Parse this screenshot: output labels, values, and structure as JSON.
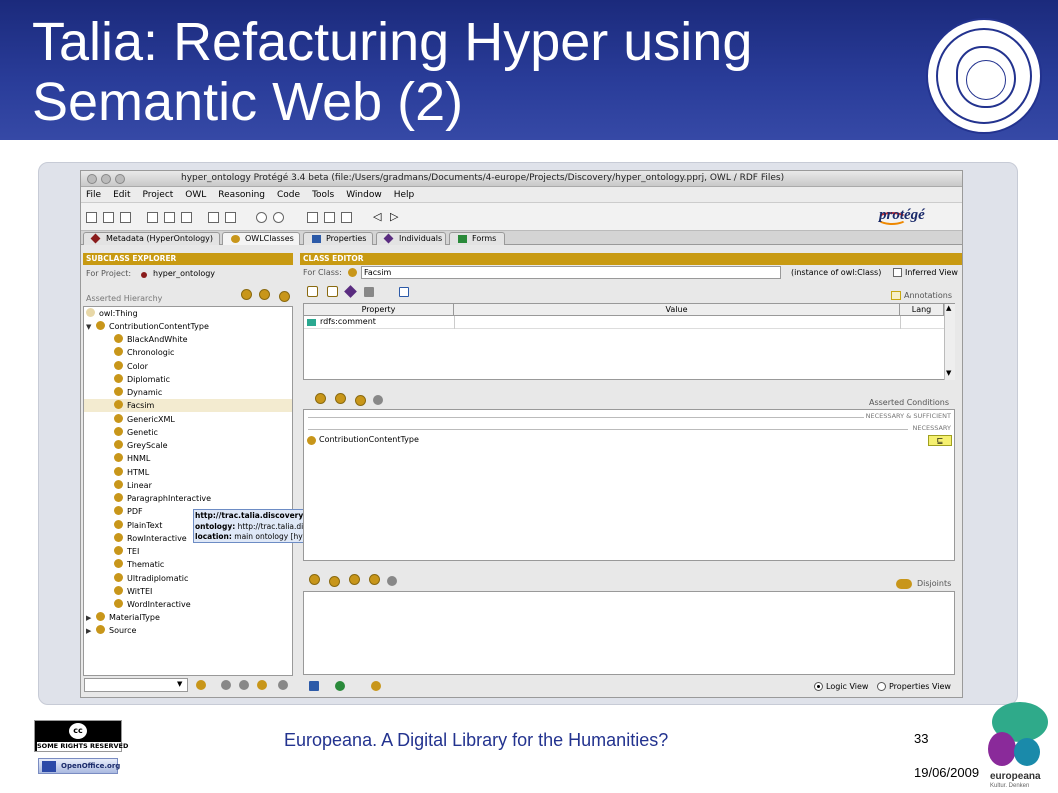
{
  "slide": {
    "title": "Talia: Refacturing Hyper using Semantic Web (2)",
    "footer": "Europeana. A Digital Library for the Humanities?",
    "page_number": "33",
    "date": "19/06/2009",
    "cc_badge": "SOME RIGHTS RESERVED",
    "cc_symbol": "cc",
    "openoffice_badge": "OpenOffice.org",
    "europeana_logo": "europeana",
    "europeana_sub": "Kultur. Denken"
  },
  "window": {
    "title": "hyper_ontology  Protégé 3.4 beta   (file:/Users/gradmans/Documents/4-europe/Projects/Discovery/hyper_ontology.pprj, OWL / RDF Files)",
    "menu": [
      "File",
      "Edit",
      "Project",
      "OWL",
      "Reasoning",
      "Code",
      "Tools",
      "Window",
      "Help"
    ],
    "logo": "protégé"
  },
  "tabs": [
    "Metadata (HyperOntology)",
    "OWLClasses",
    "Properties",
    "Individuals",
    "Forms"
  ],
  "subclass_explorer": {
    "header": "SUBCLASS EXPLORER",
    "for_project_label": "For Project:",
    "project": "hyper_ontology",
    "asserted_hierarchy": "Asserted Hierarchy",
    "root": "owl:Thing",
    "parent": "ContributionContentType",
    "children": [
      "BlackAndWhite",
      "Chronologic",
      "Color",
      "Diplomatic",
      "Dynamic",
      "Facsim",
      "GenericXML",
      "Genetic",
      "GreyScale",
      "HNML",
      "HTML",
      "Linear",
      "ParagraphInteractive",
      "PDF",
      "PlainText",
      "RowInteractive",
      "TEI",
      "Thematic",
      "Ultradiplomatic",
      "WitTEI",
      "WordInteractive"
    ],
    "selected": "Facsim",
    "others": [
      "MaterialType",
      "Source"
    ]
  },
  "tooltip": {
    "line1": "http://trac.talia.discovery-project.eu/wiki/null//trac.talia.discovery-project.eu/wiki/HyperOntology#ParagraphInteractive",
    "line2_label": "ontology:",
    "line2": " http://trac.talia.discovery-project.eu/wiki/null//trac.talia.discovery-project.eu/wiki/HyperOntology",
    "line3_label": "location:",
    "line3": " main ontology [hyper_ontology]"
  },
  "class_editor": {
    "header": "CLASS EDITOR",
    "for_class_label": "For Class:",
    "class_name": "Facsim",
    "instance_of": "(instance of owl:Class)",
    "inferred_view": "Inferred View",
    "annotations": "Annotations",
    "columns": [
      "Property",
      "Value",
      "Lang"
    ],
    "rows": [
      {
        "property": "rdfs:comment",
        "value": "",
        "lang": ""
      }
    ],
    "asserted_conditions": "Asserted Conditions",
    "necessary_sufficient": "NECESSARY & SUFFICIENT",
    "necessary": "NECESSARY",
    "condition": "ContributionContentType",
    "condition_symbol": "⊑",
    "disjoints": "Disjoints",
    "logic_view": "Logic View",
    "properties_view": "Properties View"
  }
}
